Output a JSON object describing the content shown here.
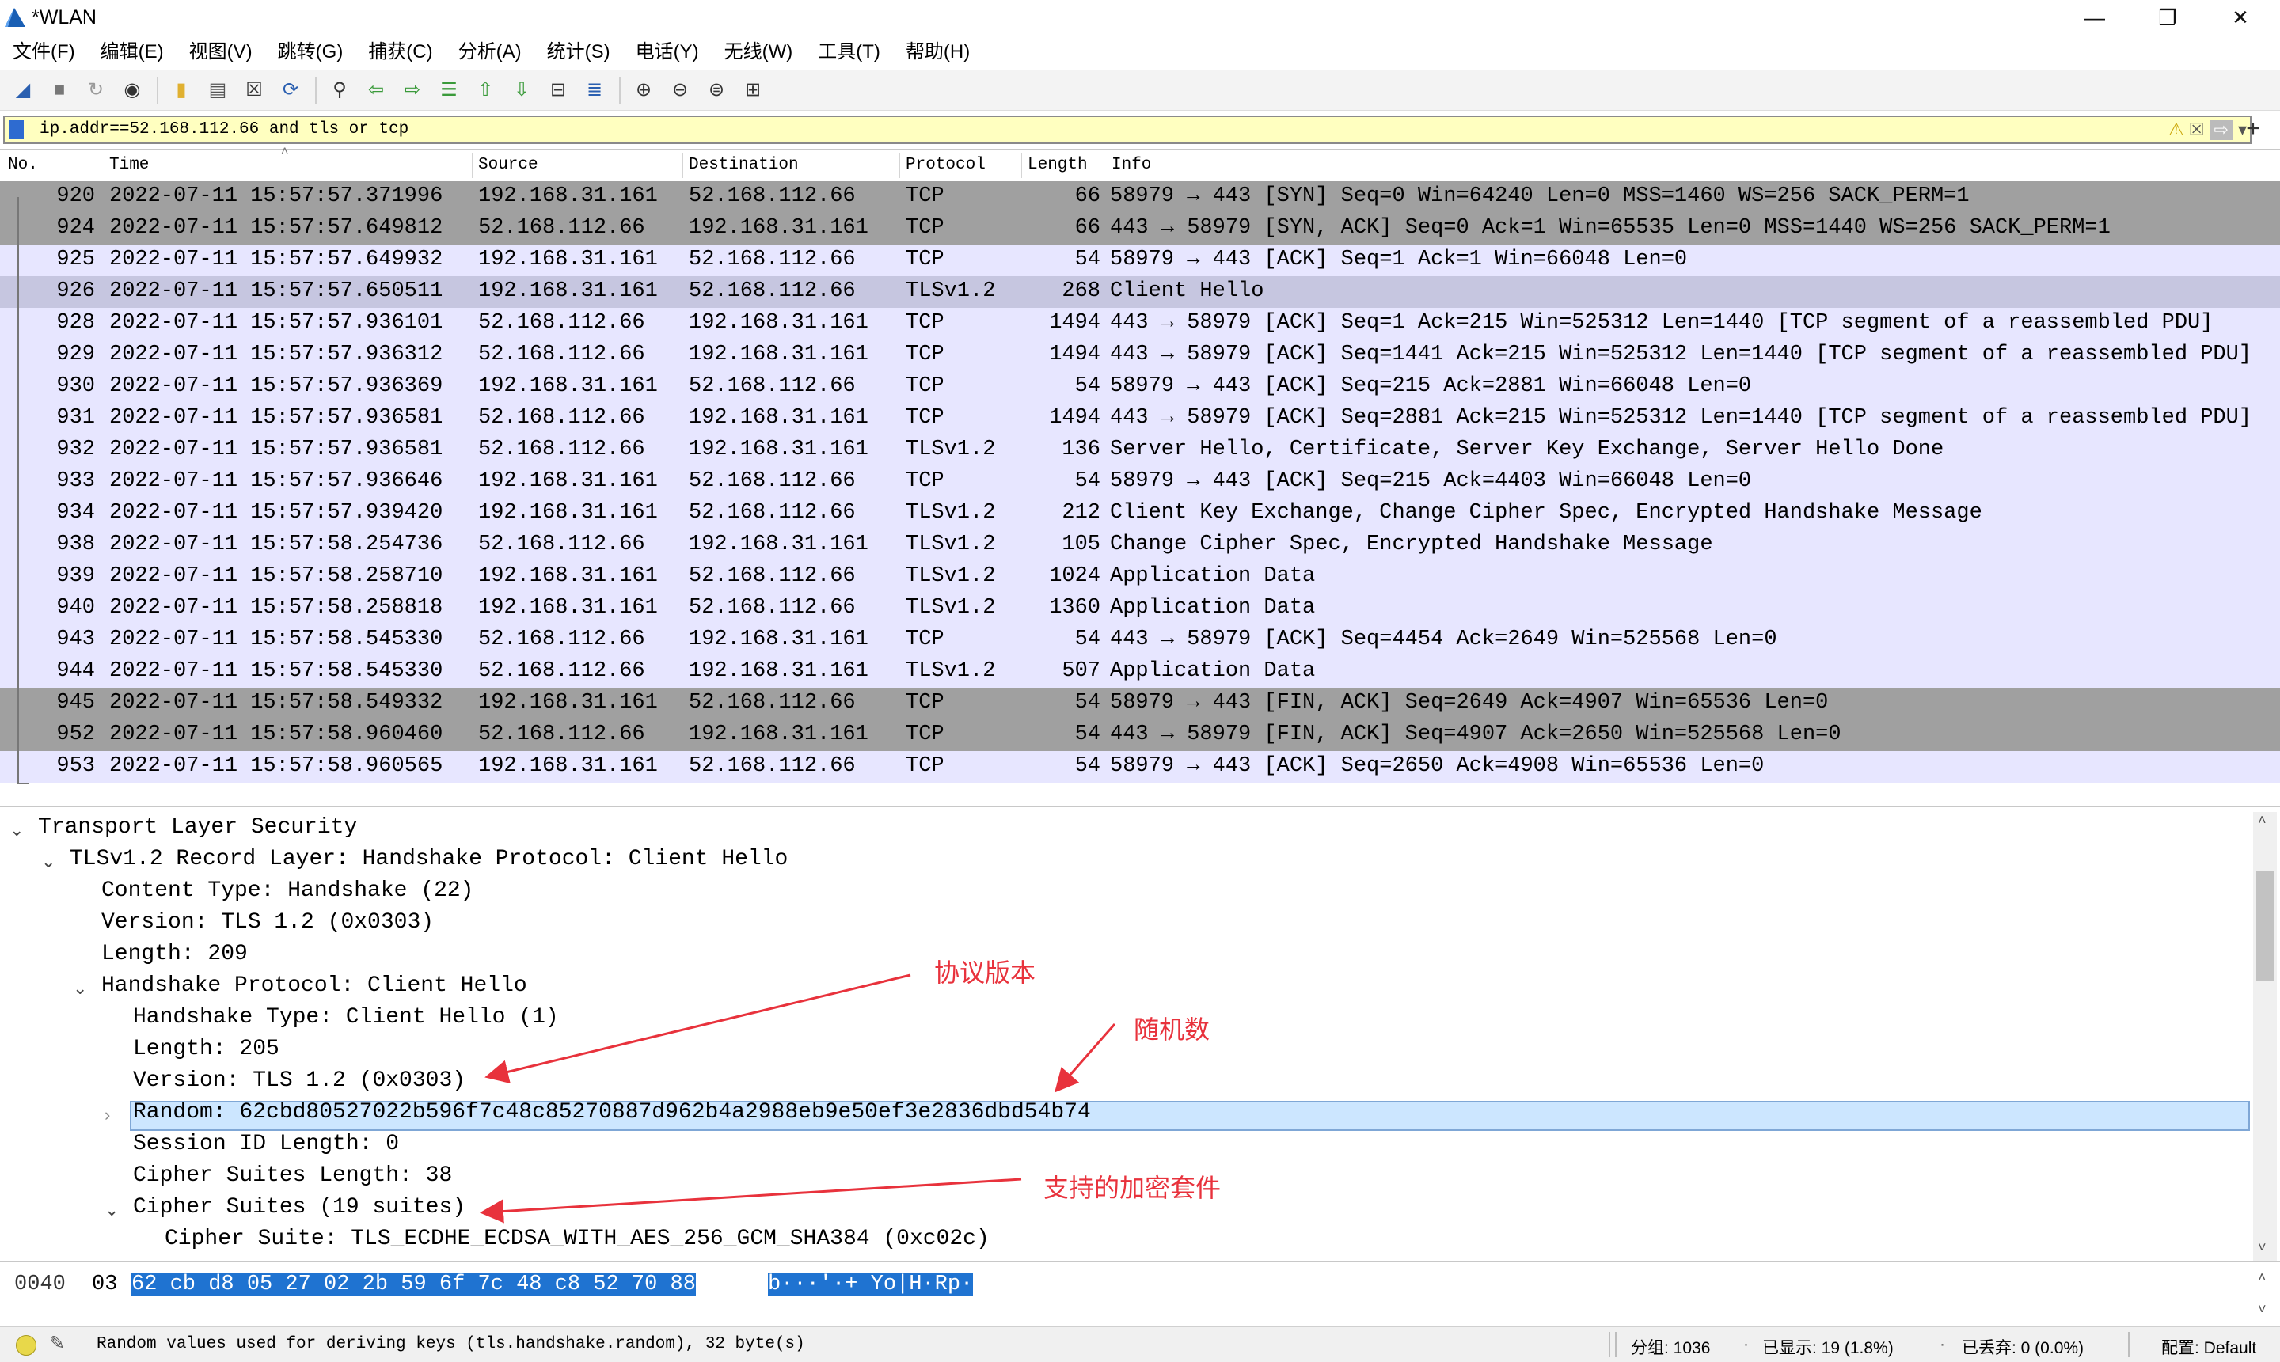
{
  "window": {
    "title": "*WLAN",
    "minimize_icon": "minimize-icon",
    "maximize_icon": "restore-icon",
    "close_icon": "close-icon"
  },
  "menus": [
    "文件(F)",
    "编辑(E)",
    "视图(V)",
    "跳转(G)",
    "捕获(C)",
    "分析(A)",
    "统计(S)",
    "电话(Y)",
    "无线(W)",
    "工具(T)",
    "帮助(H)"
  ],
  "filter": {
    "value": "ip.addr==52.168.112.66 and tls or tcp",
    "bg_color": "#ffffc0"
  },
  "columns": [
    "No.",
    "Time",
    "Source",
    "Destination",
    "Protocol",
    "Length",
    "Info"
  ],
  "packets": [
    {
      "no": "920",
      "time": "2022-07-11 15:57:57.371996",
      "src": "192.168.31.161",
      "dst": "52.168.112.66",
      "proto": "TCP",
      "len": "66",
      "info": "58979 → 443 [SYN] Seq=0 Win=64240 Len=0 MSS=1460 WS=256 SACK_PERM=1",
      "color": "#a0a0a0"
    },
    {
      "no": "924",
      "time": "2022-07-11 15:57:57.649812",
      "src": "52.168.112.66",
      "dst": "192.168.31.161",
      "proto": "TCP",
      "len": "66",
      "info": "443 → 58979 [SYN, ACK] Seq=0 Ack=1 Win=65535 Len=0 MSS=1440 WS=256 SACK_PERM=1",
      "color": "#a0a0a0"
    },
    {
      "no": "925",
      "time": "2022-07-11 15:57:57.649932",
      "src": "192.168.31.161",
      "dst": "52.168.112.66",
      "proto": "TCP",
      "len": "54",
      "info": "58979 → 443 [ACK] Seq=1 Ack=1 Win=66048 Len=0",
      "color": "#e7e6ff"
    },
    {
      "no": "926",
      "time": "2022-07-11 15:57:57.650511",
      "src": "192.168.31.161",
      "dst": "52.168.112.66",
      "proto": "TLSv1.2",
      "len": "268",
      "info": "Client Hello",
      "color": "#c6c6e0"
    },
    {
      "no": "928",
      "time": "2022-07-11 15:57:57.936101",
      "src": "52.168.112.66",
      "dst": "192.168.31.161",
      "proto": "TCP",
      "len": "1494",
      "info": "443 → 58979 [ACK] Seq=1 Ack=215 Win=525312 Len=1440 [TCP segment of a reassembled PDU]",
      "color": "#e7e6ff"
    },
    {
      "no": "929",
      "time": "2022-07-11 15:57:57.936312",
      "src": "52.168.112.66",
      "dst": "192.168.31.161",
      "proto": "TCP",
      "len": "1494",
      "info": "443 → 58979 [ACK] Seq=1441 Ack=215 Win=525312 Len=1440 [TCP segment of a reassembled PDU]",
      "color": "#e7e6ff"
    },
    {
      "no": "930",
      "time": "2022-07-11 15:57:57.936369",
      "src": "192.168.31.161",
      "dst": "52.168.112.66",
      "proto": "TCP",
      "len": "54",
      "info": "58979 → 443 [ACK] Seq=215 Ack=2881 Win=66048 Len=0",
      "color": "#e7e6ff"
    },
    {
      "no": "931",
      "time": "2022-07-11 15:57:57.936581",
      "src": "52.168.112.66",
      "dst": "192.168.31.161",
      "proto": "TCP",
      "len": "1494",
      "info": "443 → 58979 [ACK] Seq=2881 Ack=215 Win=525312 Len=1440 [TCP segment of a reassembled PDU]",
      "color": "#e7e6ff"
    },
    {
      "no": "932",
      "time": "2022-07-11 15:57:57.936581",
      "src": "52.168.112.66",
      "dst": "192.168.31.161",
      "proto": "TLSv1.2",
      "len": "136",
      "info": "Server Hello, Certificate, Server Key Exchange, Server Hello Done",
      "color": "#e7e6ff"
    },
    {
      "no": "933",
      "time": "2022-07-11 15:57:57.936646",
      "src": "192.168.31.161",
      "dst": "52.168.112.66",
      "proto": "TCP",
      "len": "54",
      "info": "58979 → 443 [ACK] Seq=215 Ack=4403 Win=66048 Len=0",
      "color": "#e7e6ff"
    },
    {
      "no": "934",
      "time": "2022-07-11 15:57:57.939420",
      "src": "192.168.31.161",
      "dst": "52.168.112.66",
      "proto": "TLSv1.2",
      "len": "212",
      "info": "Client Key Exchange, Change Cipher Spec, Encrypted Handshake Message",
      "color": "#e7e6ff"
    },
    {
      "no": "938",
      "time": "2022-07-11 15:57:58.254736",
      "src": "52.168.112.66",
      "dst": "192.168.31.161",
      "proto": "TLSv1.2",
      "len": "105",
      "info": "Change Cipher Spec, Encrypted Handshake Message",
      "color": "#e7e6ff"
    },
    {
      "no": "939",
      "time": "2022-07-11 15:57:58.258710",
      "src": "192.168.31.161",
      "dst": "52.168.112.66",
      "proto": "TLSv1.2",
      "len": "1024",
      "info": "Application Data",
      "color": "#e7e6ff"
    },
    {
      "no": "940",
      "time": "2022-07-11 15:57:58.258818",
      "src": "192.168.31.161",
      "dst": "52.168.112.66",
      "proto": "TLSv1.2",
      "len": "1360",
      "info": "Application Data",
      "color": "#e7e6ff"
    },
    {
      "no": "943",
      "time": "2022-07-11 15:57:58.545330",
      "src": "52.168.112.66",
      "dst": "192.168.31.161",
      "proto": "TCP",
      "len": "54",
      "info": "443 → 58979 [ACK] Seq=4454 Ack=2649 Win=525568 Len=0",
      "color": "#e7e6ff"
    },
    {
      "no": "944",
      "time": "2022-07-11 15:57:58.545330",
      "src": "52.168.112.66",
      "dst": "192.168.31.161",
      "proto": "TLSv1.2",
      "len": "507",
      "info": "Application Data",
      "color": "#e7e6ff"
    },
    {
      "no": "945",
      "time": "2022-07-11 15:57:58.549332",
      "src": "192.168.31.161",
      "dst": "52.168.112.66",
      "proto": "TCP",
      "len": "54",
      "info": "58979 → 443 [FIN, ACK] Seq=2649 Ack=4907 Win=65536 Len=0",
      "color": "#a0a0a0"
    },
    {
      "no": "952",
      "time": "2022-07-11 15:57:58.960460",
      "src": "52.168.112.66",
      "dst": "192.168.31.161",
      "proto": "TCP",
      "len": "54",
      "info": "443 → 58979 [FIN, ACK] Seq=4907 Ack=2650 Win=525568 Len=0",
      "color": "#a0a0a0"
    },
    {
      "no": "953",
      "time": "2022-07-11 15:57:58.960565",
      "src": "192.168.31.161",
      "dst": "52.168.112.66",
      "proto": "TCP",
      "len": "54",
      "info": "58979 → 443 [ACK] Seq=2650 Ack=4908 Win=65536 Len=0",
      "color": "#e7e6ff"
    }
  ],
  "details": {
    "tls": "Transport Layer Security",
    "record": "TLSv1.2 Record Layer: Handshake Protocol: Client Hello",
    "content_type": "Content Type: Handshake (22)",
    "version": "Version: TLS 1.2 (0x0303)",
    "length": "Length: 209",
    "handshake": "Handshake Protocol: Client Hello",
    "hs_type": "Handshake Type: Client Hello (1)",
    "hs_length": "Length: 205",
    "hs_version": "Version: TLS 1.2 (0x0303)",
    "random": "Random: 62cbd80527022b596f7c48c85270887d962b4a2988eb9e50ef3e2836dbd54b74",
    "session_id_len": "Session ID Length: 0",
    "cipher_len": "Cipher Suites Length: 38",
    "cipher_suites": "Cipher Suites (19 suites)",
    "cipher_suite": "Cipher Suite: TLS_ECDHE_ECDSA_WITH_AES_256_GCM_SHA384 (0xc02c)"
  },
  "annotations": {
    "version": "协议版本",
    "random": "随机数",
    "ciphers": "支持的加密套件",
    "color": "#e8323c"
  },
  "bytes": {
    "offset": "0040",
    "plain": "03",
    "hex_selected": "62 cb d8 05 27 02 2b  59 6f 7c 48 c8 52 70 88",
    "ascii_selected": "b···'·+ Yo|H·Rp·"
  },
  "status": {
    "field": "Random values used for deriving keys (tls.handshake.random), 32 byte(s)",
    "packets": "分组: 1036",
    "displayed": "已显示: 19 (1.8%)",
    "dropped": "已丢弃: 0 (0.0%)",
    "profile": "配置: Default"
  }
}
